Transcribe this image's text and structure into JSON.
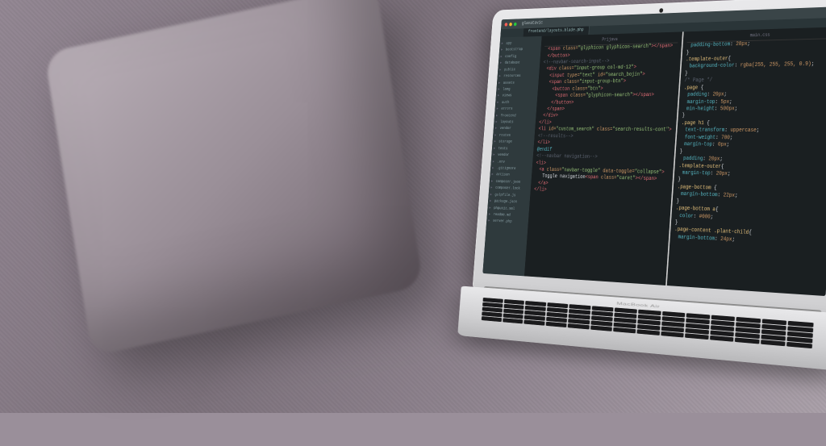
{
  "scene": {
    "label": "MacBook Air on grey couch with cushion",
    "laptop_model": "MacBook Air"
  },
  "editor": {
    "window_title": "glavatavic",
    "tabs": [
      "frontend/layouts.blade.php"
    ],
    "sidebar_items": [
      "app",
      "bootstrap",
      "config",
      "database",
      "public",
      "resources",
      "assets",
      "lang",
      "views",
      "auth",
      "errors",
      "frontend",
      "layouts",
      "vendor",
      "routes",
      "storage",
      "tests",
      "vendor",
      ".env",
      ".gitignore",
      "artisan",
      "composer.json",
      "composer.lock",
      "gulpfile.js",
      "package.json",
      "phpunit.xml",
      "readme.md",
      "server.php"
    ],
    "left_pane": {
      "title": "Prijava",
      "lines": [
        {
          "cls": "i1",
          "spans": [
            [
              "c-red",
              "<span "
            ],
            [
              "c-orange",
              "class="
            ],
            [
              "c-green",
              "\"glyphicon glyphicon-search\""
            ],
            [
              "c-red",
              "></span>"
            ]
          ]
        },
        {
          "cls": "i1",
          "spans": [
            [
              "c-red",
              "</button>"
            ]
          ]
        },
        {
          "cls": "",
          "spans": [
            [
              "c-grey",
              "<!--navbar-search-input-->"
            ]
          ]
        },
        {
          "cls": "i1",
          "spans": [
            [
              "c-red",
              "<div "
            ],
            [
              "c-orange",
              "class="
            ],
            [
              "c-green",
              "\"input-group col-md-12\""
            ],
            [
              "c-red",
              ">"
            ]
          ]
        },
        {
          "cls": "i2",
          "spans": [
            [
              "c-red",
              "<input "
            ],
            [
              "c-orange",
              "type="
            ],
            [
              "c-green",
              "\"text\""
            ],
            [
              "c-orange",
              " id="
            ],
            [
              "c-green",
              "\"search_bojin\""
            ],
            [
              "c-red",
              ">"
            ]
          ]
        },
        {
          "cls": "i2",
          "spans": [
            [
              "c-red",
              "<span "
            ],
            [
              "c-orange",
              "class="
            ],
            [
              "c-green",
              "\"input-group-btn\""
            ],
            [
              "c-red",
              ">"
            ]
          ]
        },
        {
          "cls": "i3",
          "spans": [
            [
              "c-red",
              "<button "
            ],
            [
              "c-orange",
              "class="
            ],
            [
              "c-green",
              "\"btn\""
            ],
            [
              "c-red",
              ">"
            ]
          ]
        },
        {
          "cls": "i4",
          "spans": [
            [
              "c-red",
              "<span "
            ],
            [
              "c-orange",
              "class="
            ],
            [
              "c-green",
              "\"glyphicon-search\""
            ],
            [
              "c-red",
              "></span>"
            ]
          ]
        },
        {
          "cls": "i3",
          "spans": [
            [
              "c-red",
              "</button>"
            ]
          ]
        },
        {
          "cls": "i2",
          "spans": [
            [
              "c-red",
              "</span>"
            ]
          ]
        },
        {
          "cls": "i1",
          "spans": [
            [
              "c-red",
              "</div>"
            ]
          ]
        },
        {
          "cls": "",
          "spans": [
            [
              "c-red",
              "</li>"
            ]
          ]
        },
        {
          "cls": "",
          "spans": [
            [
              "c-red",
              "<li "
            ],
            [
              "c-orange",
              "id="
            ],
            [
              "c-green",
              "\"custom_search\""
            ],
            [
              "c-orange",
              " class="
            ],
            [
              "c-green",
              "\"search-results-cont\""
            ],
            [
              "c-red",
              ">"
            ]
          ]
        },
        {
          "cls": "",
          "spans": [
            [
              "c-grey",
              "<!--results-->"
            ]
          ]
        },
        {
          "cls": "",
          "spans": [
            [
              "c-red",
              "</li>"
            ]
          ]
        },
        {
          "cls": "",
          "spans": [
            [
              "c-white",
              ""
            ]
          ]
        },
        {
          "cls": "",
          "spans": [
            [
              "c-teal",
              "@endif"
            ]
          ]
        },
        {
          "cls": "",
          "spans": [
            [
              "c-grey",
              "<!--navbar navigation-->"
            ]
          ]
        },
        {
          "cls": "",
          "spans": [
            [
              "c-red",
              "<li>"
            ]
          ]
        },
        {
          "cls": "i1",
          "spans": [
            [
              "c-red",
              "<a "
            ],
            [
              "c-orange",
              "class="
            ],
            [
              "c-green",
              "\"navbar-toggle\""
            ],
            [
              "c-orange",
              " data-toggle="
            ],
            [
              "c-green",
              "\"collapse\""
            ],
            [
              "c-red",
              ">"
            ]
          ]
        },
        {
          "cls": "i2",
          "spans": [
            [
              "c-white",
              "Toggle navigation"
            ],
            [
              "c-red",
              "<span "
            ],
            [
              "c-orange",
              "class="
            ],
            [
              "c-green",
              "\"caret\""
            ],
            [
              "c-red",
              "></span>"
            ]
          ]
        },
        {
          "cls": "i1",
          "spans": [
            [
              "c-red",
              "</a>"
            ]
          ]
        },
        {
          "cls": "",
          "spans": [
            [
              "c-red",
              "</li>"
            ]
          ]
        }
      ]
    },
    "right_pane": {
      "title": "main.css",
      "lines": [
        {
          "cls": "i1",
          "spans": [
            [
              "c-teal",
              "padding-bottom"
            ],
            [
              "c-white",
              ": "
            ],
            [
              "c-orange",
              "20px"
            ],
            [
              "c-white",
              ";"
            ]
          ]
        },
        {
          "cls": "",
          "spans": [
            [
              "c-white",
              "}"
            ]
          ]
        },
        {
          "cls": "",
          "spans": [
            [
              "c-yellow",
              ".template-outer"
            ],
            [
              "c-white",
              "{"
            ]
          ]
        },
        {
          "cls": "i1",
          "spans": [
            [
              "c-teal",
              "background-color"
            ],
            [
              "c-white",
              ": "
            ],
            [
              "c-orange",
              "rgba(255, 255, 255, 0.9)"
            ],
            [
              "c-white",
              ";"
            ]
          ]
        },
        {
          "cls": "",
          "spans": [
            [
              "c-white",
              "}"
            ]
          ]
        },
        {
          "cls": "",
          "spans": [
            [
              "c-grey",
              "/* Page */"
            ]
          ]
        },
        {
          "cls": "",
          "spans": [
            [
              "c-yellow",
              ".page"
            ],
            [
              "c-white",
              " {"
            ]
          ]
        },
        {
          "cls": "i1",
          "spans": [
            [
              "c-teal",
              "padding"
            ],
            [
              "c-white",
              ": "
            ],
            [
              "c-orange",
              "20px"
            ],
            [
              "c-white",
              ";"
            ]
          ]
        },
        {
          "cls": "i1",
          "spans": [
            [
              "c-teal",
              "margin-top"
            ],
            [
              "c-white",
              ": "
            ],
            [
              "c-orange",
              "5px"
            ],
            [
              "c-white",
              ";"
            ]
          ]
        },
        {
          "cls": "i1",
          "spans": [
            [
              "c-teal",
              "min-height"
            ],
            [
              "c-white",
              ": "
            ],
            [
              "c-orange",
              "500px"
            ],
            [
              "c-white",
              ";"
            ]
          ]
        },
        {
          "cls": "",
          "spans": [
            [
              "c-white",
              "}"
            ]
          ]
        },
        {
          "cls": "",
          "spans": [
            [
              "c-yellow",
              ".page"
            ],
            [
              "c-white",
              " "
            ],
            [
              "c-yellow",
              "h1"
            ],
            [
              "c-white",
              " {"
            ]
          ]
        },
        {
          "cls": "i1",
          "spans": [
            [
              "c-teal",
              "text-transform"
            ],
            [
              "c-white",
              ": "
            ],
            [
              "c-orange",
              "uppercase"
            ],
            [
              "c-white",
              ";"
            ]
          ]
        },
        {
          "cls": "i1",
          "spans": [
            [
              "c-teal",
              "font-weight"
            ],
            [
              "c-white",
              ": "
            ],
            [
              "c-orange",
              "700"
            ],
            [
              "c-white",
              ";"
            ]
          ]
        },
        {
          "cls": "i1",
          "spans": [
            [
              "c-teal",
              "margin-top"
            ],
            [
              "c-white",
              ": "
            ],
            [
              "c-orange",
              "0px"
            ],
            [
              "c-white",
              ";"
            ]
          ]
        },
        {
          "cls": "",
          "spans": [
            [
              "c-white",
              "}"
            ]
          ]
        },
        {
          "cls": "i1",
          "spans": [
            [
              "c-teal",
              "padding"
            ],
            [
              "c-white",
              ": "
            ],
            [
              "c-orange",
              "20px"
            ],
            [
              "c-white",
              ";"
            ]
          ]
        },
        {
          "cls": "",
          "spans": [
            [
              "c-yellow",
              ".template-outer"
            ],
            [
              "c-white",
              "{"
            ]
          ]
        },
        {
          "cls": "i1",
          "spans": [
            [
              "c-teal",
              "margin-top"
            ],
            [
              "c-white",
              ": "
            ],
            [
              "c-orange",
              "20px"
            ],
            [
              "c-white",
              ";"
            ]
          ]
        },
        {
          "cls": "",
          "spans": [
            [
              "c-white",
              "}"
            ]
          ]
        },
        {
          "cls": "",
          "spans": [
            [
              "c-yellow",
              ".page-bottom"
            ],
            [
              "c-white",
              " {"
            ]
          ]
        },
        {
          "cls": "i1",
          "spans": [
            [
              "c-teal",
              "margin-bottom"
            ],
            [
              "c-white",
              ": "
            ],
            [
              "c-orange",
              "22px"
            ],
            [
              "c-white",
              ";"
            ]
          ]
        },
        {
          "cls": "",
          "spans": [
            [
              "c-white",
              "}"
            ]
          ]
        },
        {
          "cls": "",
          "spans": [
            [
              "c-yellow",
              ".page-bottom"
            ],
            [
              "c-white",
              " "
            ],
            [
              "c-yellow",
              "a"
            ],
            [
              "c-white",
              "{"
            ]
          ]
        },
        {
          "cls": "i1",
          "spans": [
            [
              "c-teal",
              "color"
            ],
            [
              "c-white",
              ": "
            ],
            [
              "c-orange",
              "#000"
            ],
            [
              "c-white",
              ";"
            ]
          ]
        },
        {
          "cls": "",
          "spans": [
            [
              "c-white",
              "}"
            ]
          ]
        },
        {
          "cls": "",
          "spans": [
            [
              "c-yellow",
              ".page-content"
            ],
            [
              "c-white",
              " "
            ],
            [
              "c-yellow",
              ".plant-child"
            ],
            [
              "c-white",
              "{"
            ]
          ]
        },
        {
          "cls": "i1",
          "spans": [
            [
              "c-teal",
              "margin-bottom"
            ],
            [
              "c-white",
              ": "
            ],
            [
              "c-orange",
              "24px"
            ],
            [
              "c-white",
              ";"
            ]
          ]
        }
      ]
    }
  }
}
